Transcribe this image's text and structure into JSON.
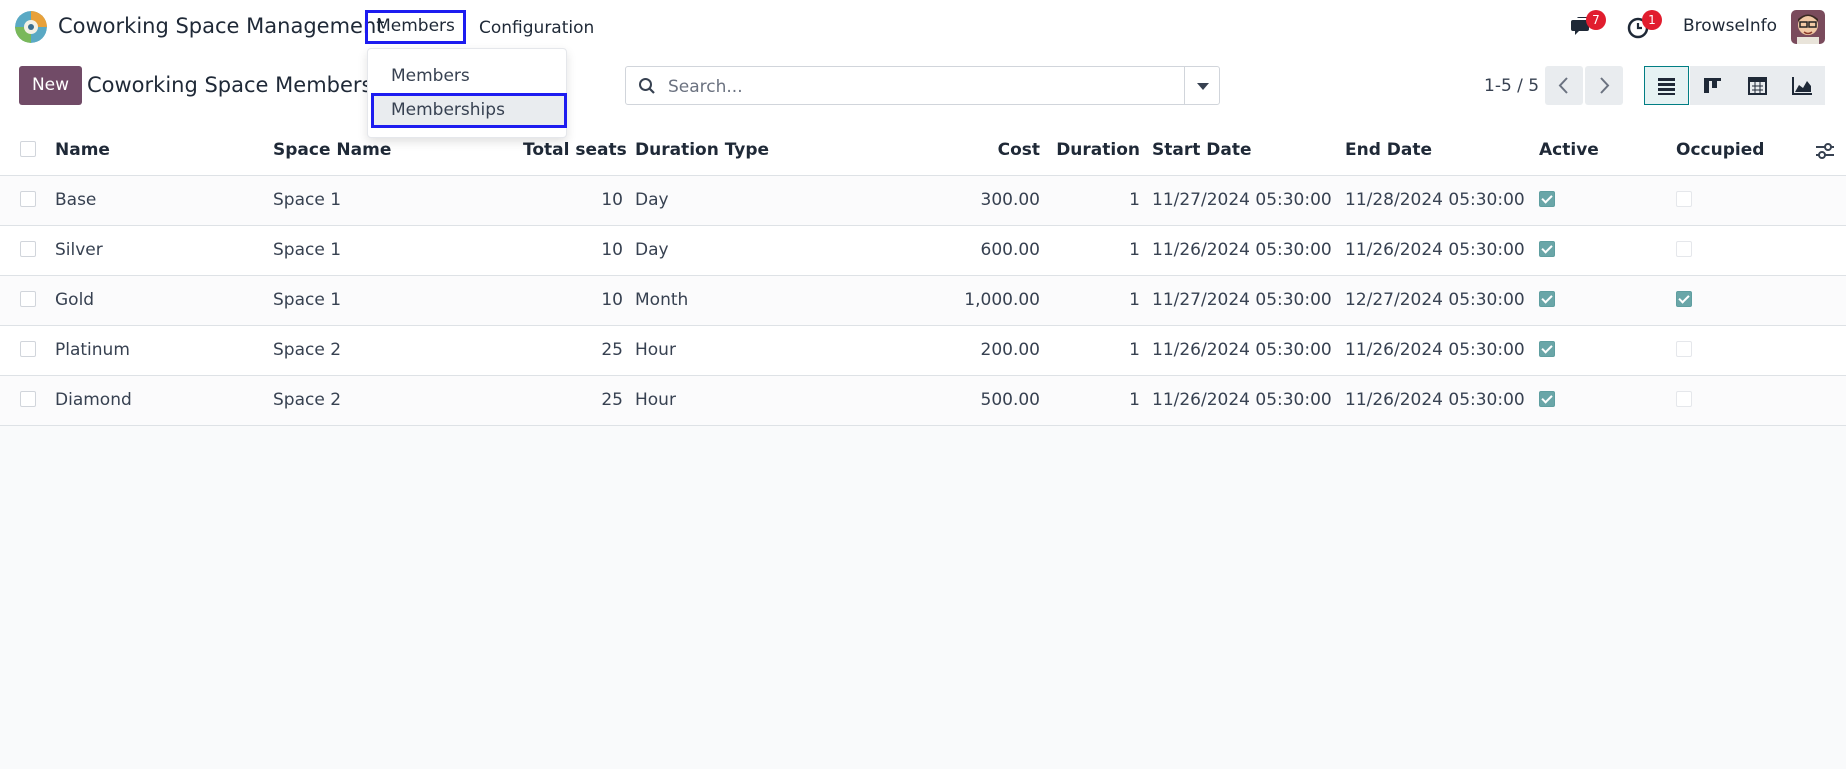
{
  "app": {
    "title": "Coworking Space Management"
  },
  "navbar": {
    "menus": [
      "Members",
      "Configuration"
    ],
    "messages_badge": "7",
    "activities_badge": "1",
    "user_name": "BrowseInfo"
  },
  "dropdown": {
    "items": [
      "Members",
      "Memberships"
    ]
  },
  "control_panel": {
    "new_label": "New",
    "breadcrumb": "Coworking Space Memberships",
    "search_placeholder": "Search...",
    "pager": "1-5 / 5"
  },
  "table": {
    "columns": [
      "Name",
      "Space Name",
      "Total seats",
      "Duration Type",
      "Cost",
      "Duration",
      "Start Date",
      "End Date",
      "Active",
      "Occupied"
    ],
    "rows": [
      {
        "name": "Base",
        "space": "Space 1",
        "seats": "10",
        "dtype": "Day",
        "cost": "300.00",
        "duration": "1",
        "start": "11/27/2024 05:30:00",
        "end": "11/28/2024 05:30:00",
        "active": true,
        "occupied": false
      },
      {
        "name": "Silver",
        "space": "Space 1",
        "seats": "10",
        "dtype": "Day",
        "cost": "600.00",
        "duration": "1",
        "start": "11/26/2024 05:30:00",
        "end": "11/26/2024 05:30:00",
        "active": true,
        "occupied": false
      },
      {
        "name": "Gold",
        "space": "Space 1",
        "seats": "10",
        "dtype": "Month",
        "cost": "1,000.00",
        "duration": "1",
        "start": "11/27/2024 05:30:00",
        "end": "12/27/2024 05:30:00",
        "active": true,
        "occupied": true
      },
      {
        "name": "Platinum",
        "space": "Space 2",
        "seats": "25",
        "dtype": "Hour",
        "cost": "200.00",
        "duration": "1",
        "start": "11/26/2024 05:30:00",
        "end": "11/26/2024 05:30:00",
        "active": true,
        "occupied": false
      },
      {
        "name": "Diamond",
        "space": "Space 2",
        "seats": "25",
        "dtype": "Hour",
        "cost": "500.00",
        "duration": "1",
        "start": "11/26/2024 05:30:00",
        "end": "11/26/2024 05:30:00",
        "active": true,
        "occupied": false
      }
    ]
  },
  "colors": {
    "brand": "#714b67",
    "accent": "#017e84",
    "highlight": "#1d1cf0",
    "badge": "#e11d2e"
  }
}
